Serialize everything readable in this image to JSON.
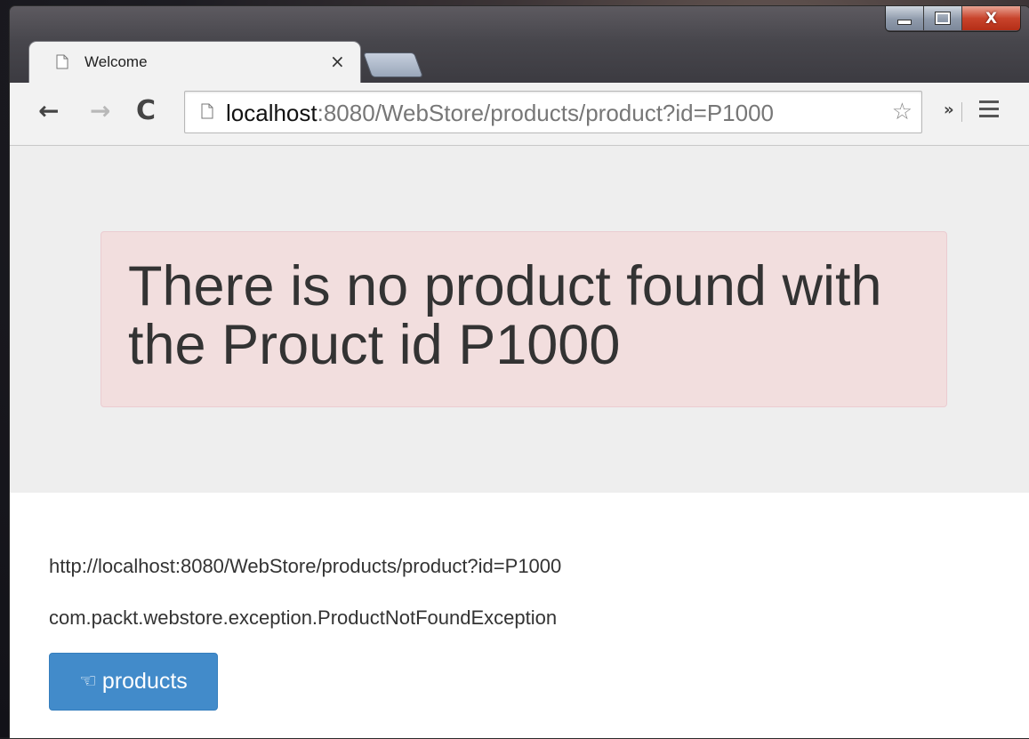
{
  "browser": {
    "tab": {
      "title": "Welcome",
      "close_glyph": "×"
    },
    "window_controls": {
      "close_glyph": "X"
    },
    "toolbar": {
      "back_glyph": "←",
      "forward_glyph": "→",
      "reload_glyph": "C",
      "url_host": "localhost",
      "url_path": ":8080/WebStore/products/product?id=P1000",
      "star_glyph": "☆",
      "extensions_glyph": "»"
    }
  },
  "page": {
    "alert_message": "There is no product found with the Prouct id P1000",
    "request_url": "http://localhost:8080/WebStore/products/product?id=P1000",
    "exception": "com.packt.webstore.exception.ProductNotFoundException",
    "products_button": {
      "icon": "hand-pointing-left-icon",
      "label": "products"
    }
  },
  "colors": {
    "alert_bg": "#f2dede",
    "jumbotron_bg": "#eeeeee",
    "button_primary": "#428bca"
  }
}
